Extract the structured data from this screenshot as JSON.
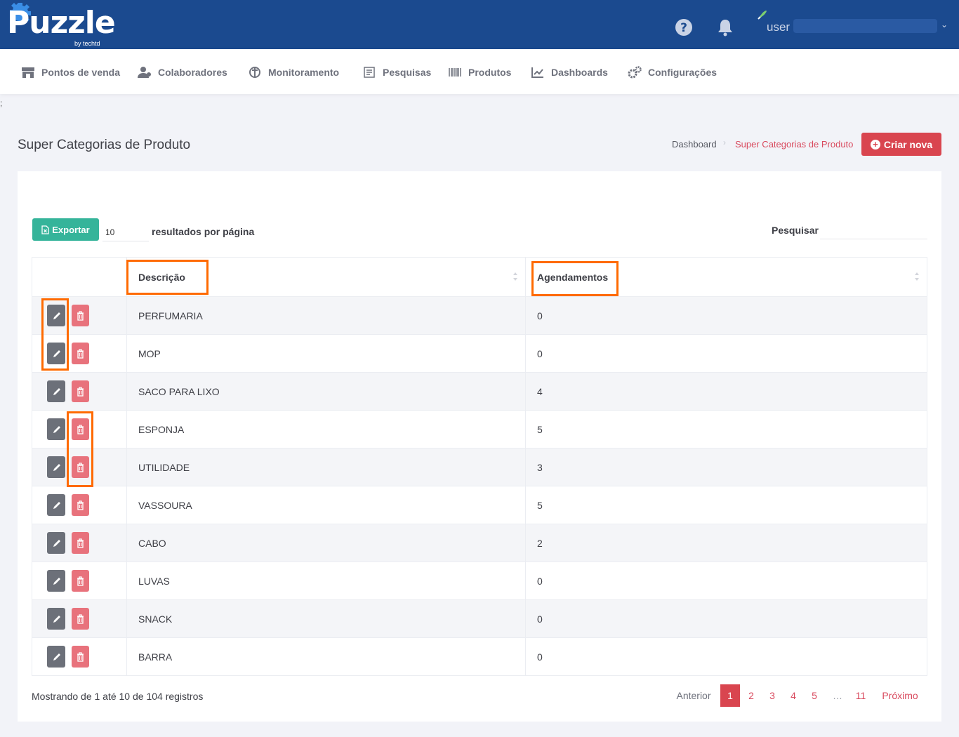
{
  "header": {
    "logo": "Puzzle",
    "logo_sub": "by techtd",
    "user_name": "user"
  },
  "nav": [
    {
      "label": "Pontos de venda",
      "icon": "store-icon"
    },
    {
      "label": "Colaboradores",
      "icon": "users-icon"
    },
    {
      "label": "Monitoramento",
      "icon": "monitor-icon"
    },
    {
      "label": "Pesquisas",
      "icon": "survey-icon"
    },
    {
      "label": "Produtos",
      "icon": "barcode-icon"
    },
    {
      "label": "Dashboards",
      "icon": "chart-icon"
    },
    {
      "label": "Configurações",
      "icon": "gears-icon"
    }
  ],
  "stray_text": ";",
  "subheader": {
    "title": "Super Categorias de Produto",
    "breadcrumb": [
      "Dashboard",
      "Super Categorias de Produto"
    ],
    "new_button": "Criar nova"
  },
  "toolbar": {
    "export_label": "Exportar",
    "page_length": "10",
    "page_length_label": "resultados por página",
    "search_label": "Pesquisar"
  },
  "table": {
    "columns": [
      "",
      "Descrição",
      "Agendamentos"
    ],
    "rows": [
      {
        "descricao": "PERFUMARIA",
        "agendamentos": "0"
      },
      {
        "descricao": "MOP",
        "agendamentos": "0"
      },
      {
        "descricao": "SACO PARA LIXO",
        "agendamentos": "4"
      },
      {
        "descricao": "ESPONJA",
        "agendamentos": "5"
      },
      {
        "descricao": "UTILIDADE",
        "agendamentos": "3"
      },
      {
        "descricao": "VASSOURA",
        "agendamentos": "5"
      },
      {
        "descricao": "CABO",
        "agendamentos": "2"
      },
      {
        "descricao": "LUVAS",
        "agendamentos": "0"
      },
      {
        "descricao": "SNACK",
        "agendamentos": "0"
      },
      {
        "descricao": "BARRA",
        "agendamentos": "0"
      }
    ]
  },
  "footer": {
    "info": "Mostrando de 1 até 10 de 104 registros",
    "prev": "Anterior",
    "pages": [
      "1",
      "2",
      "3",
      "4",
      "5",
      "…",
      "11"
    ],
    "active_page": "1",
    "next": "Próximo"
  },
  "colors": {
    "header_bg": "#1b4a8f",
    "accent_red": "#d9454f",
    "export_green": "#35b49a",
    "highlight": "#ff6a00"
  }
}
